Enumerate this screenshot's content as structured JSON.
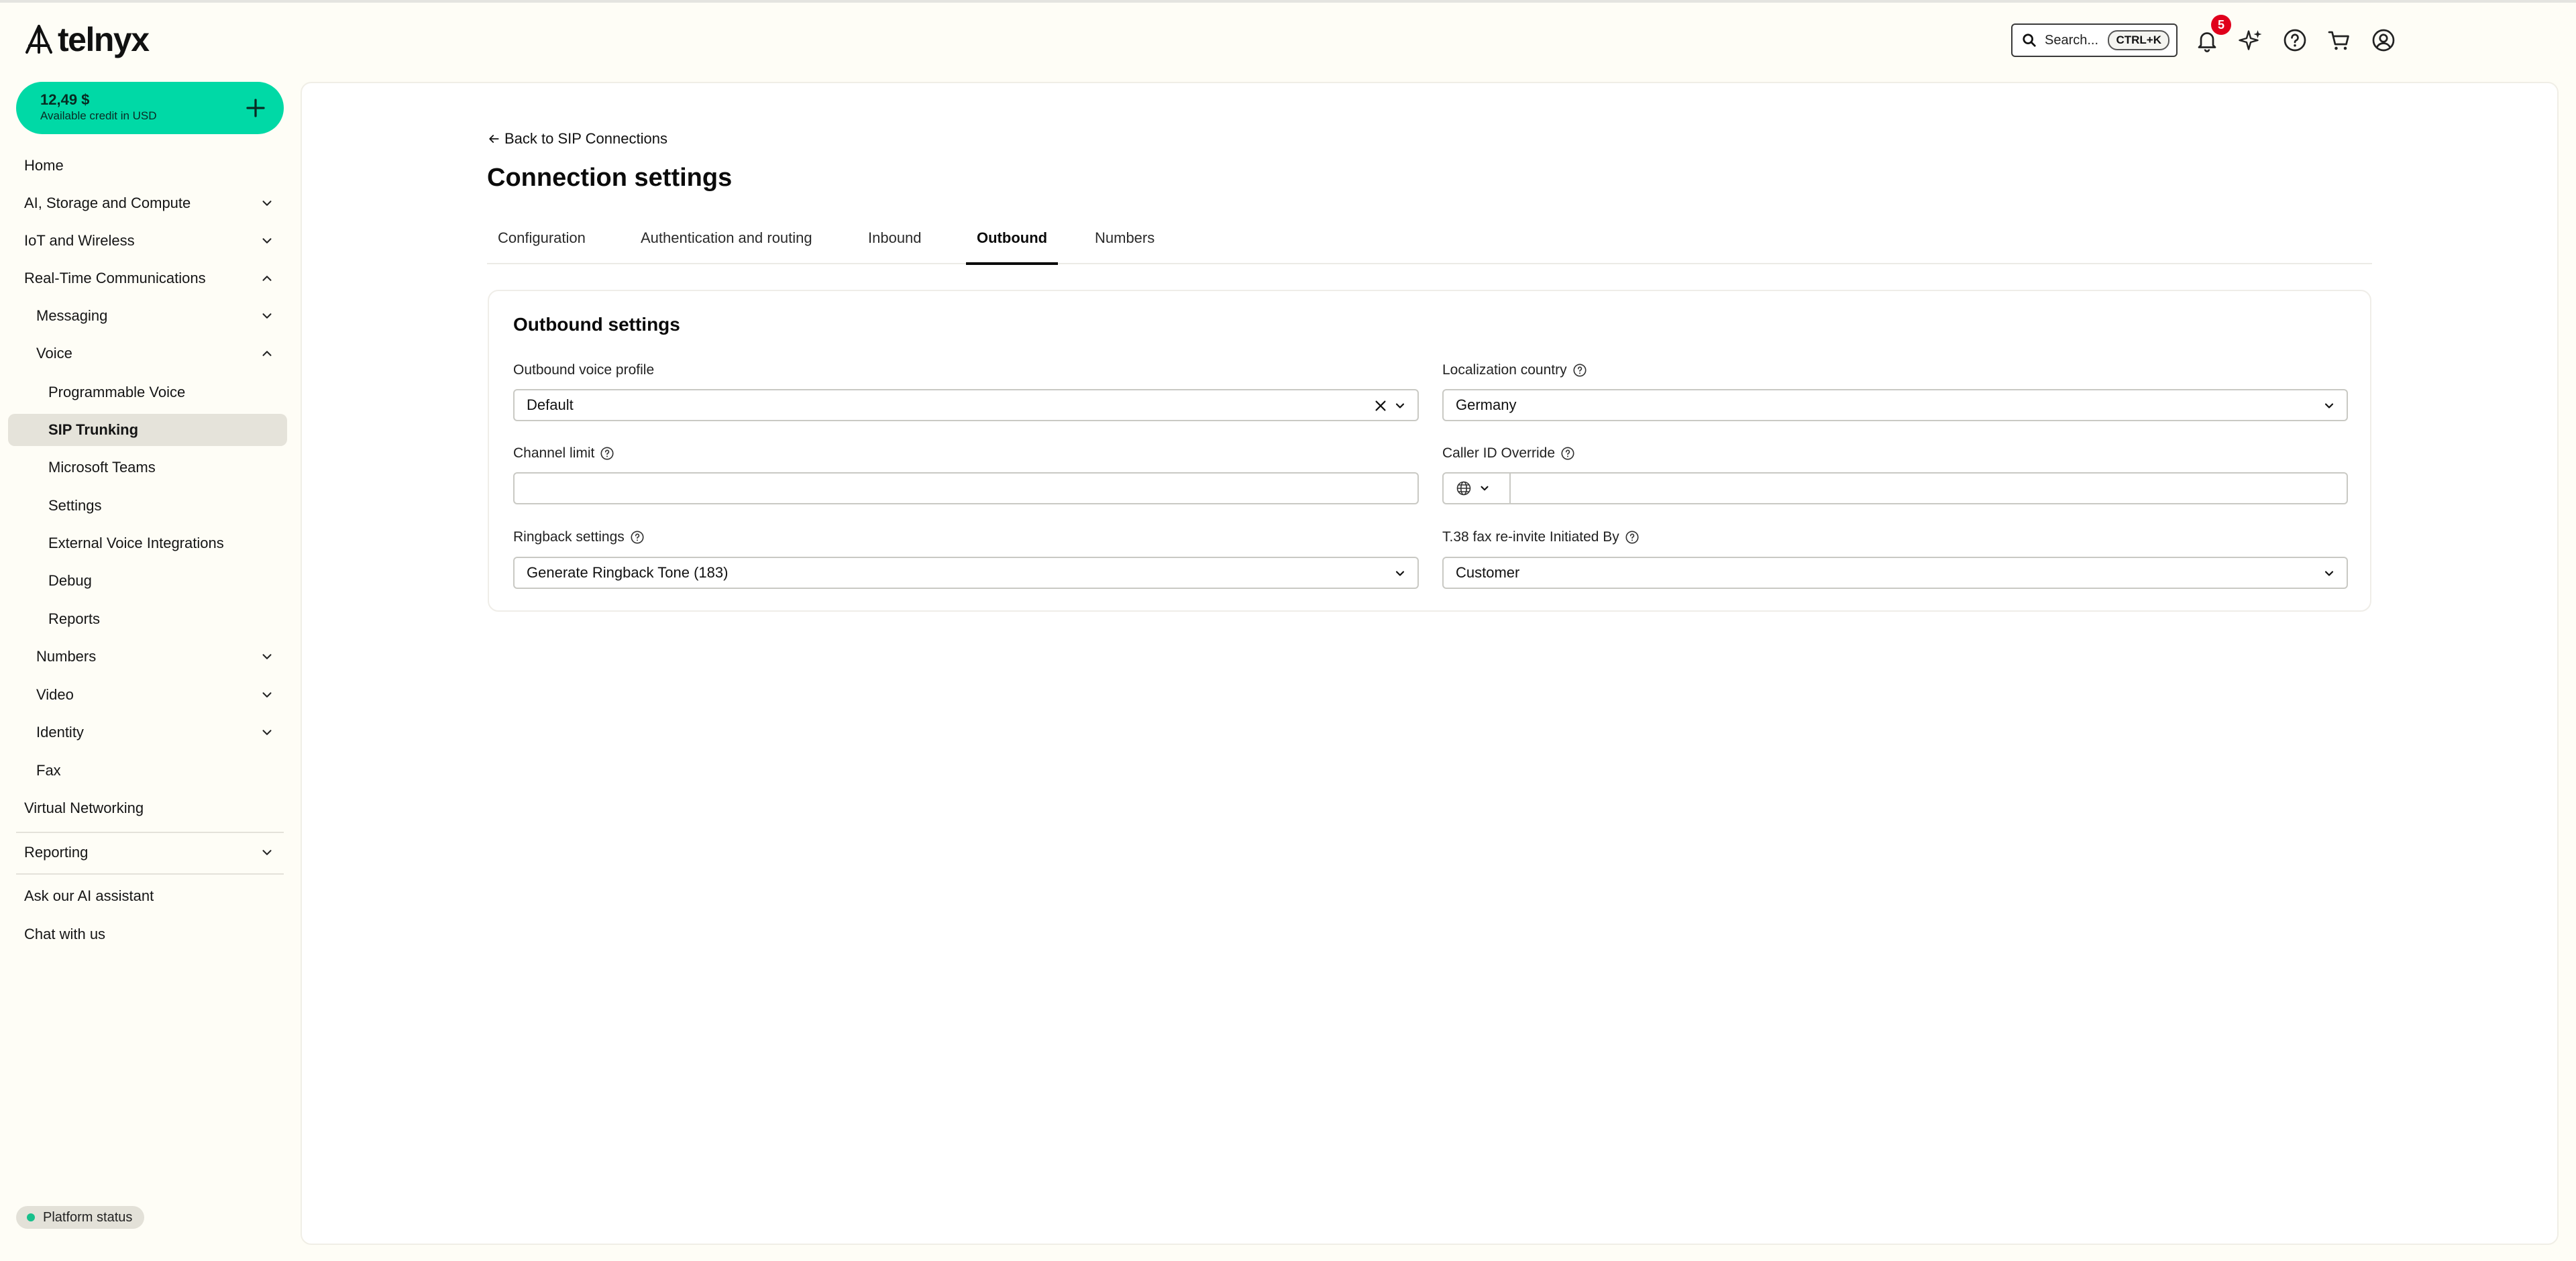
{
  "app": {
    "logo_text": "telnyx"
  },
  "topbar": {
    "search_placeholder": "Search...",
    "search_shortcut": "CTRL+K",
    "notification_count": "5"
  },
  "sidebar": {
    "credit_amount": "12,49 $",
    "credit_label": "Available credit in USD",
    "items": [
      {
        "label": "Home"
      },
      {
        "label": "AI, Storage and Compute"
      },
      {
        "label": "IoT and Wireless"
      },
      {
        "label": "Real-Time Communications"
      },
      {
        "label": "Messaging"
      },
      {
        "label": "Voice"
      },
      {
        "label": "Programmable Voice"
      },
      {
        "label": "SIP Trunking"
      },
      {
        "label": "Microsoft Teams"
      },
      {
        "label": "Settings"
      },
      {
        "label": "External Voice Integrations"
      },
      {
        "label": "Debug"
      },
      {
        "label": "Reports"
      },
      {
        "label": "Numbers"
      },
      {
        "label": "Video"
      },
      {
        "label": "Identity"
      },
      {
        "label": "Fax"
      },
      {
        "label": "Virtual Networking"
      },
      {
        "label": "Reporting"
      },
      {
        "label": "Ask our AI assistant"
      },
      {
        "label": "Chat with us"
      }
    ],
    "platform_status": "Platform status"
  },
  "main": {
    "back_link": "Back to SIP Connections",
    "title": "Connection settings",
    "tabs": [
      {
        "label": "Configuration"
      },
      {
        "label": "Authentication and routing"
      },
      {
        "label": "Inbound"
      },
      {
        "label": "Outbound"
      },
      {
        "label": "Numbers"
      }
    ],
    "active_tab": "Outbound",
    "card": {
      "title": "Outbound settings",
      "outbound_voice_profile": {
        "label": "Outbound voice profile",
        "value": "Default"
      },
      "localization_country": {
        "label": "Localization country",
        "value": "Germany"
      },
      "channel_limit": {
        "label": "Channel limit",
        "value": ""
      },
      "caller_id_override": {
        "label": "Caller ID Override",
        "value": ""
      },
      "ringback_settings": {
        "label": "Ringback settings",
        "value": "Generate Ringback Tone (183)"
      },
      "t38_fax": {
        "label": "T.38 fax re-invite Initiated By",
        "value": "Customer"
      }
    }
  },
  "colors": {
    "page_background": "#fefdf6",
    "accent_green": "#00d9a6",
    "notification_red": "#e0001b",
    "active_nav_background": "#e5e3da"
  },
  "icons": [
    "telnyx-logo-icon",
    "search-icon",
    "bell-icon",
    "sparkle-icon",
    "help-icon",
    "cart-icon",
    "user-icon",
    "plus-icon",
    "chevron-down-icon",
    "chevron-up-icon",
    "arrow-left-icon",
    "close-icon",
    "globe-icon",
    "status-dot-icon"
  ]
}
